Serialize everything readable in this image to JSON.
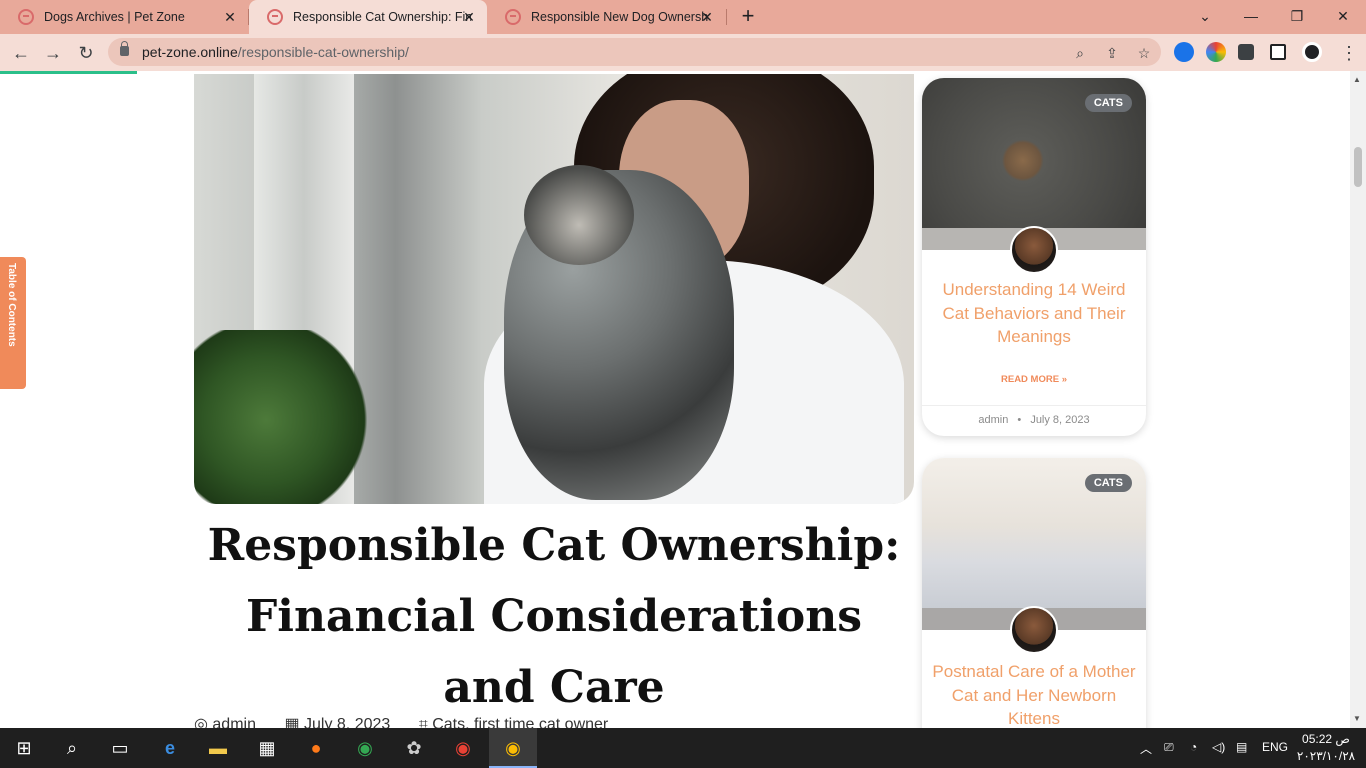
{
  "browser": {
    "tabs": [
      {
        "title": "Dogs Archives | Pet Zone",
        "active": false
      },
      {
        "title": "Responsible Cat Ownership: Fina",
        "active": true
      },
      {
        "title": "Responsible New Dog Ownershi",
        "active": false
      }
    ],
    "new_tab": "+",
    "url_host": "pet-zone.online",
    "url_path": "/responsible-cat-ownership/",
    "colors": {
      "tabbar": "#e8a99a",
      "active_tab": "#f5ddd6",
      "load_bar": "#2bbf8a"
    }
  },
  "article": {
    "title": "Responsible Cat Ownership: Financial Considerations and Care",
    "author": "admin",
    "date": "July 8, 2023",
    "categories": "Cats, first time cat owner"
  },
  "toc": {
    "label": "Table of Contents"
  },
  "sidebar": {
    "cards": [
      {
        "badge": "CATS",
        "title": "Understanding 14 Weird Cat Behaviors and Their Meanings",
        "read_more": "READ MORE »",
        "author": "admin",
        "date": "July 8, 2023"
      },
      {
        "badge": "CATS",
        "title": "Postnatal Care of a Mother Cat and Her Newborn Kittens"
      }
    ]
  },
  "scroll_top": "^",
  "taskbar": {
    "language": "ENG",
    "time": "05:22 ص",
    "date": "٢٠٢٣/١٠/٢٨"
  }
}
